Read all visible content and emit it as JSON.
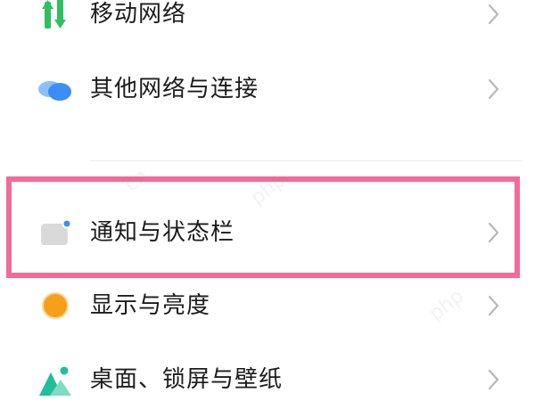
{
  "settings": {
    "items": [
      {
        "label": "移动网络",
        "icon": "mobile-data-icon"
      },
      {
        "label": "其他网络与连接",
        "icon": "cloud-connection-icon"
      },
      {
        "label": "通知与状态栏",
        "icon": "notification-icon"
      },
      {
        "label": "显示与亮度",
        "icon": "display-brightness-icon"
      },
      {
        "label": "桌面、锁屏与壁纸",
        "icon": "wallpaper-icon"
      }
    ]
  },
  "watermark": {
    "text_1": "php",
    "text_2": "cn"
  },
  "colors": {
    "highlight": "#f06b9a",
    "mobile_green": "#2fbf5f",
    "cloud_blue": "#3a8ef6",
    "notify_dot": "#3a8ef6",
    "display_orange": "#f6a019",
    "wallpaper_teal": "#1fbf9a"
  }
}
